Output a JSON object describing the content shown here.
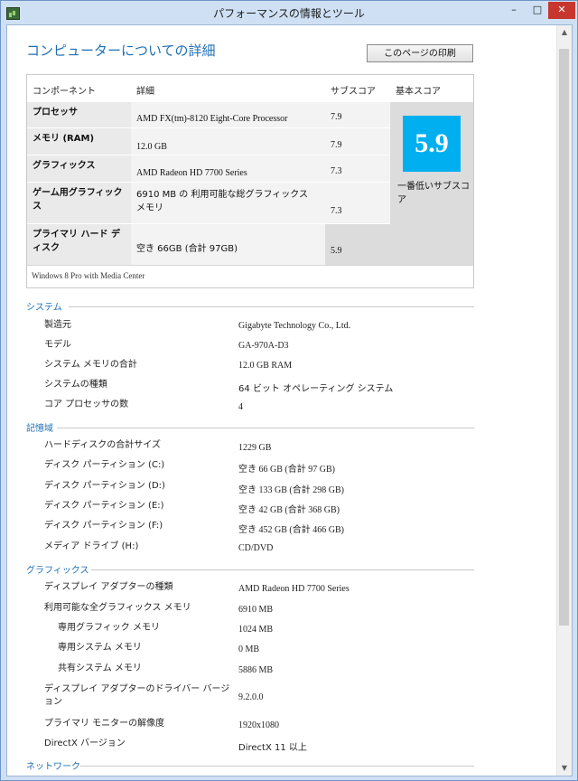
{
  "window": {
    "title": "パフォーマンスの情報とツール",
    "controls": {
      "minimize": "–",
      "maximize": "□",
      "close": "✕"
    }
  },
  "header": {
    "title": "コンピューターについての詳細",
    "print_button": "このページの印刷"
  },
  "scores": {
    "columns": {
      "component": "コンポーネント",
      "detail": "詳細",
      "subscore": "サブスコア",
      "base": "基本スコア"
    },
    "rows": [
      {
        "component": "プロセッサ",
        "detail": "AMD FX(tm)-8120 Eight-Core Processor",
        "subscore": "7.9"
      },
      {
        "component": "メモリ (RAM)",
        "detail": "12.0 GB",
        "subscore": "7.9"
      },
      {
        "component": "グラフィックス",
        "detail": "AMD Radeon HD 7700 Series",
        "subscore": "7.3"
      },
      {
        "component": "ゲーム用グラフィックス",
        "detail": "6910 MB の 利用可能な総グラフィックス メモリ",
        "subscore": "7.3"
      },
      {
        "component": "プライマリ ハード ディスク",
        "detail": "空き 66GB (合計 97GB)",
        "subscore": "5.9"
      }
    ],
    "base_score": "5.9",
    "base_note": "一番低いサブスコア",
    "tile_color": "#00aff0",
    "os": "Windows 8 Pro with Media Center"
  },
  "system": {
    "heading": "システム",
    "items": [
      {
        "label": "製造元",
        "value": "Gigabyte Technology Co., Ltd."
      },
      {
        "label": "モデル",
        "value": "GA-970A-D3"
      },
      {
        "label": "システム メモリの合計",
        "value": "12.0 GB RAM"
      },
      {
        "label": "システムの種類",
        "value": "64 ビット オペレーティング システム"
      },
      {
        "label": "コア プロセッサの数",
        "value": "4"
      }
    ]
  },
  "storage": {
    "heading": "記憶域",
    "items": [
      {
        "label": "ハードディスクの合計サイズ",
        "value": "1229 GB"
      },
      {
        "label": "ディスク パーティション (C:)",
        "value": "空き 66 GB (合計 97 GB)"
      },
      {
        "label": "ディスク パーティション (D:)",
        "value": "空き 133 GB (合計 298 GB)"
      },
      {
        "label": "ディスク パーティション (E:)",
        "value": "空き 42 GB (合計 368 GB)"
      },
      {
        "label": "ディスク パーティション (F:)",
        "value": "空き 452 GB (合計 466 GB)"
      },
      {
        "label": "メディア ドライブ (H:)",
        "value": "CD/DVD"
      }
    ]
  },
  "graphics": {
    "heading": "グラフィックス",
    "items": [
      {
        "label": "ディスプレイ アダプターの種類",
        "value": "AMD Radeon HD 7700 Series"
      },
      {
        "label": "利用可能な全グラフィックス メモリ",
        "value": "6910 MB"
      },
      {
        "label": "専用グラフィック メモリ",
        "value": "1024 MB"
      },
      {
        "label": "専用システム メモリ",
        "value": "0 MB"
      },
      {
        "label": "共有システム メモリ",
        "value": "5886 MB"
      },
      {
        "label": "ディスプレイ アダプターのドライバー バージョン",
        "value": "9.2.0.0"
      },
      {
        "label": "プライマリ モニターの解像度",
        "value": "1920x1080"
      },
      {
        "label": "DirectX バージョン",
        "value": "DirectX 11 以上"
      }
    ]
  },
  "network": {
    "heading": "ネットワーク"
  }
}
